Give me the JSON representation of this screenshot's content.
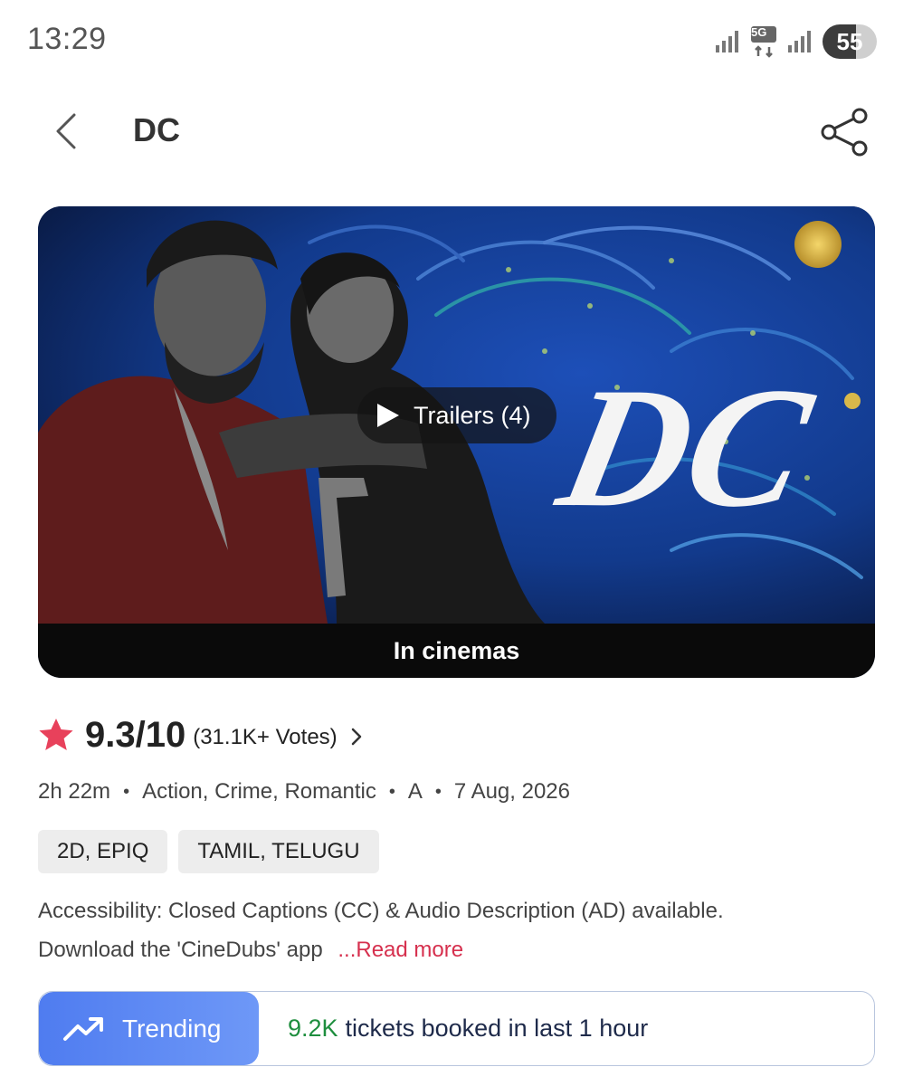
{
  "status_bar": {
    "time": "13:29",
    "network_label": "5G",
    "battery": "55"
  },
  "header": {
    "title": "DC"
  },
  "poster": {
    "logo_text": "DC",
    "trailer_label": "Trailers (4)",
    "banner": "In cinemas"
  },
  "rating": {
    "value": "9.3/10",
    "votes": "(31.1K+ Votes)",
    "star_color": "#e8415b"
  },
  "meta": {
    "duration": "2h 22m",
    "genres": "Action, Crime, Romantic",
    "certificate": "A",
    "release_date": "7 Aug, 2026"
  },
  "tags": [
    "2D, EPIQ",
    "TAMIL, TELUGU"
  ],
  "description": {
    "line1": "Accessibility: Closed Captions (CC) & Audio Description (AD) available.",
    "line2": "Download the 'CineDubs' app",
    "read_more": "...Read more"
  },
  "trending": {
    "label": "Trending",
    "count": "9.2K",
    "text": "tickets booked in last 1 hour"
  },
  "icons": {
    "back": "chevron-left-icon",
    "share": "share-icon",
    "star": "star-icon",
    "chevron": "chevron-right-icon",
    "play": "play-icon",
    "trend": "trending-up-icon"
  },
  "colors": {
    "accent_red": "#d6304e",
    "trending_blue": "#5b86f3",
    "trending_green": "#1e8e3e"
  }
}
